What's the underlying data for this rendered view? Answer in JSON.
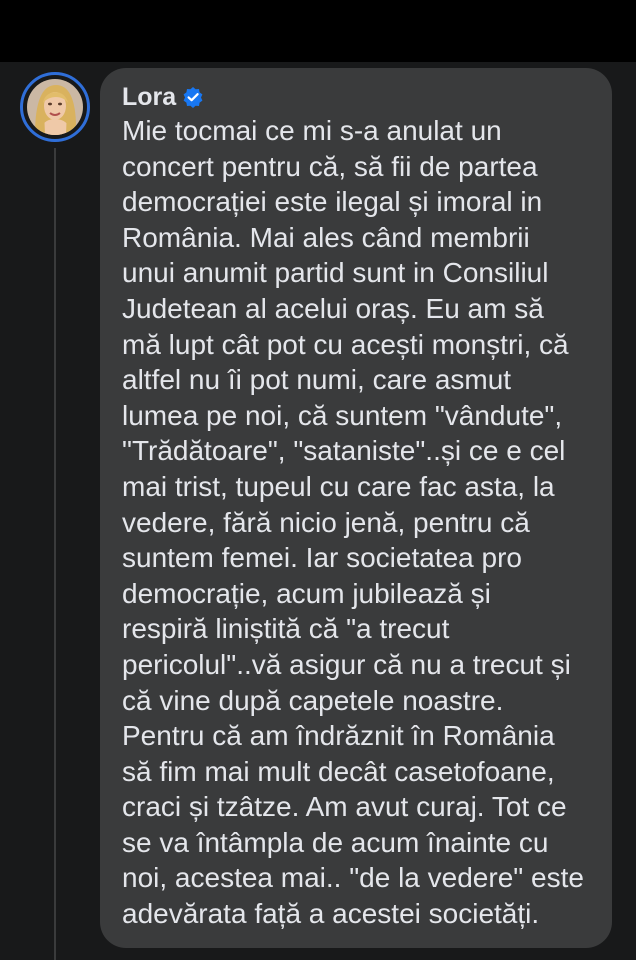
{
  "comment": {
    "author": "Lora",
    "verified_icon": "verified-badge-icon",
    "text": "Mie tocmai ce mi s-a anulat un\nconcert pentru că, să fii de partea\ndemocrației este ilegal și imoral in\nRomânia. Mai ales când membrii\nunui anumit partid sunt in Consiliul\nJudetean al acelui oraș. Eu am să\nmă lupt cât pot cu acești monștri, că\naltfel nu îi pot numi, care asmut\nlumea pe noi, că suntem \"vândute\",\n\"Trădătoare\", \"sataniste\"..și ce e cel\nmai trist, tupeul cu care fac asta, la\nvedere, fără nicio jenă, pentru că\nsuntem femei. Iar societatea pro\ndemocrație, acum jubilează și\nrespiră liniștită că \"a trecut\npericolul\"..vă asigur că nu a trecut și\ncă vine după capetele noastre.\nPentru că am îndrăznit în România\nsă fim mai mult decât casetofoane,\ncraci și tzâtze. Am avut curaj. Tot ce\nse va întâmpla de acum înainte  cu\nnoi, acestea mai.. \"de la vedere\" este\nadevărata față a acestei societăți."
  },
  "colors": {
    "background": "#18191a",
    "bubble": "#3a3b3c",
    "text": "#e4e6eb",
    "verified": "#1877f2",
    "avatar_ring": "#2f6ed8"
  }
}
